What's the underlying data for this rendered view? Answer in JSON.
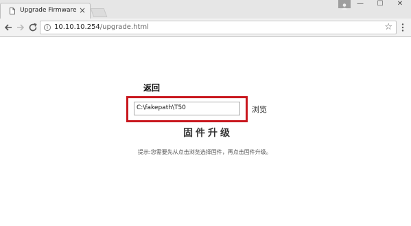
{
  "browser": {
    "tab_title": "Upgrade Firmware",
    "tab_close": "×",
    "url_host": "10.10.10.254",
    "url_path": "/upgrade.html",
    "window_minimize": "—",
    "window_maximize": "☐",
    "window_close": "✕"
  },
  "page": {
    "back_label": "返回",
    "file_path_value": "C:\\fakepath\\T50",
    "browse_label": "浏览",
    "upgrade_label": "固件升级",
    "hint_text": "提示:您需要先从点击浏览选择固件，再点击固件升级。"
  },
  "colors": {
    "highlight_border": "#c8161d"
  }
}
